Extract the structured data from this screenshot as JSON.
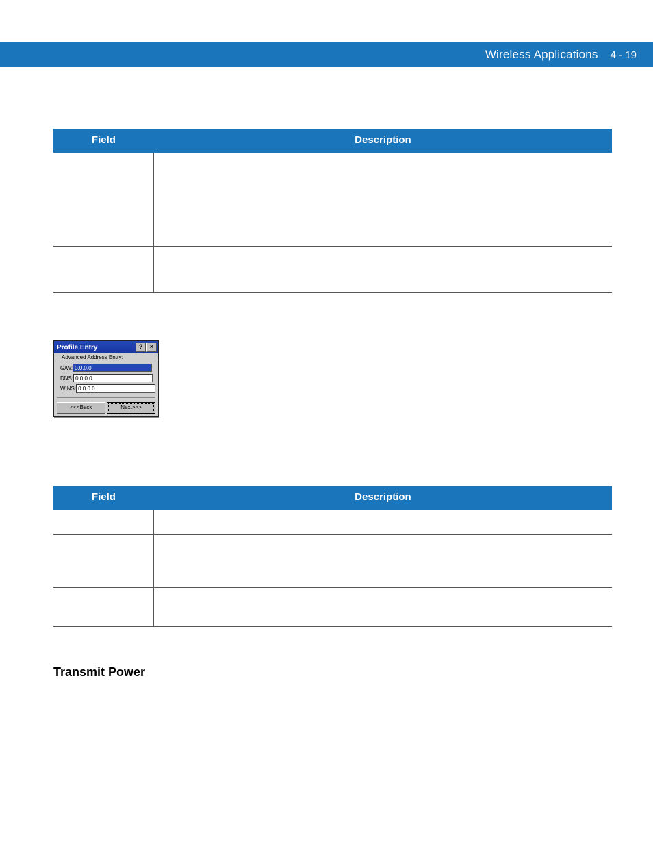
{
  "header": {
    "section_title": "Wireless Applications",
    "page_number": "4 - 19"
  },
  "table1": {
    "head": {
      "field": "Field",
      "description": "Description"
    },
    "rows": [
      {
        "field": "",
        "description": ""
      },
      {
        "field": "",
        "description": ""
      }
    ]
  },
  "screenshot": {
    "window_title": "Profile Entry",
    "group_label": "Advanced Address Entry:",
    "fields": {
      "gw_label": "G/W:",
      "gw_value": "0.0.0.0",
      "dns_label": "DNS:",
      "dns_value": "0.0.0.0",
      "wins_label": "WINS:",
      "wins_value": "0.0.0.0"
    },
    "buttons": {
      "back": "<<<Back",
      "next": "Next>>>"
    },
    "titlebar_icons": {
      "help": "?",
      "close": "×"
    }
  },
  "figure_caption": "",
  "table2": {
    "head": {
      "field": "Field",
      "description": "Description"
    },
    "rows": [
      {
        "field": "",
        "description": ""
      },
      {
        "field": "",
        "description": ""
      },
      {
        "field": "",
        "description": ""
      }
    ]
  },
  "section_heading": "Transmit Power"
}
